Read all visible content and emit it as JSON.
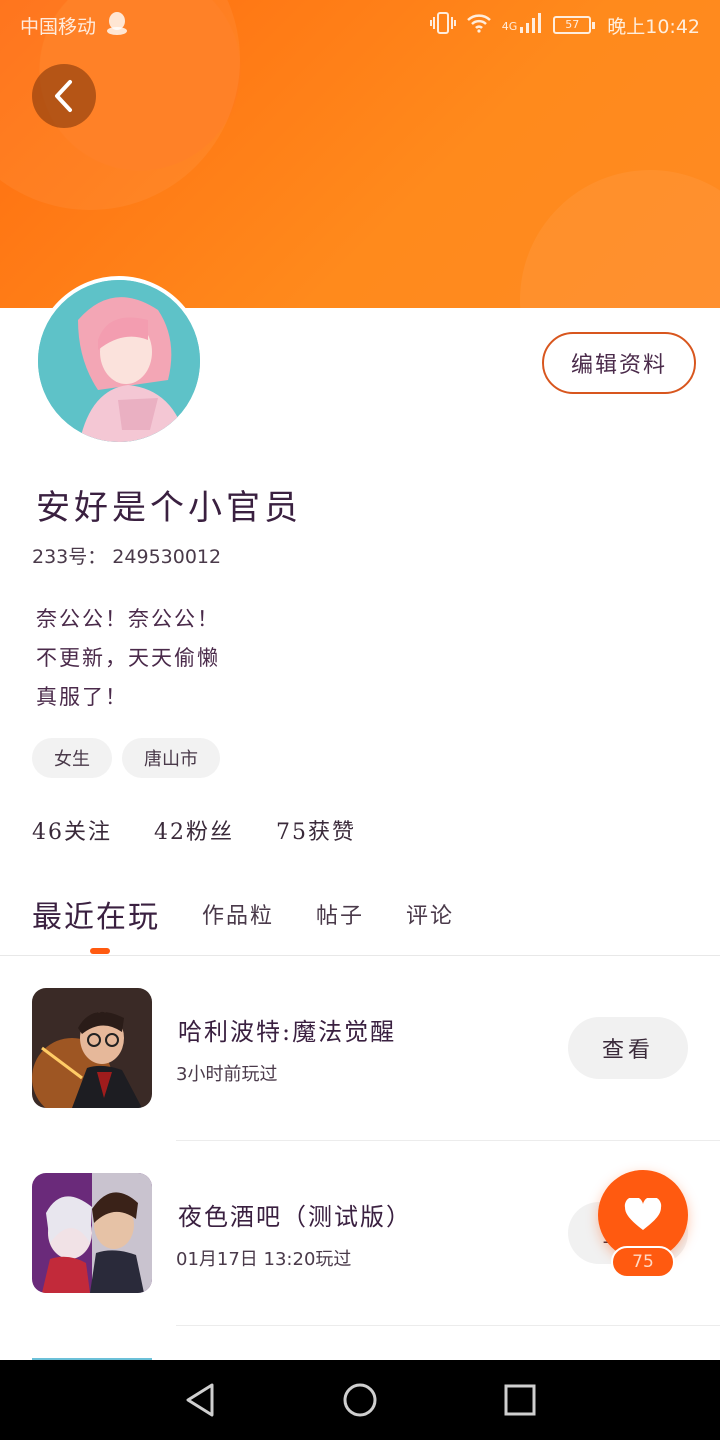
{
  "status_bar": {
    "carrier": "中国移动",
    "network": "4G",
    "battery": "57",
    "time": "晚上10:42"
  },
  "profile": {
    "edit_label": "编辑资料",
    "name": "安好是个小官员",
    "uid": "233号： 249530012",
    "bio": [
      "奈公公！奈公公！",
      "不更新，天天偷懒",
      "真服了！"
    ],
    "tags": [
      "女生",
      "唐山市"
    ],
    "stats": [
      "46关注",
      "42粉丝",
      "75获赞"
    ]
  },
  "tabs": [
    "最近在玩",
    "作品粒",
    "帖子",
    "评论"
  ],
  "games": [
    {
      "title": "哈利波特:魔法觉醒",
      "subtitle": "3小时前玩过",
      "action": "查看"
    },
    {
      "title": "夜色酒吧（测试版）",
      "subtitle": "01月17日 13:20玩过",
      "action": "查看"
    }
  ],
  "fab": {
    "count": "75"
  },
  "colors": {
    "accent": "#ff5a10",
    "header": "#ff7a1a"
  }
}
